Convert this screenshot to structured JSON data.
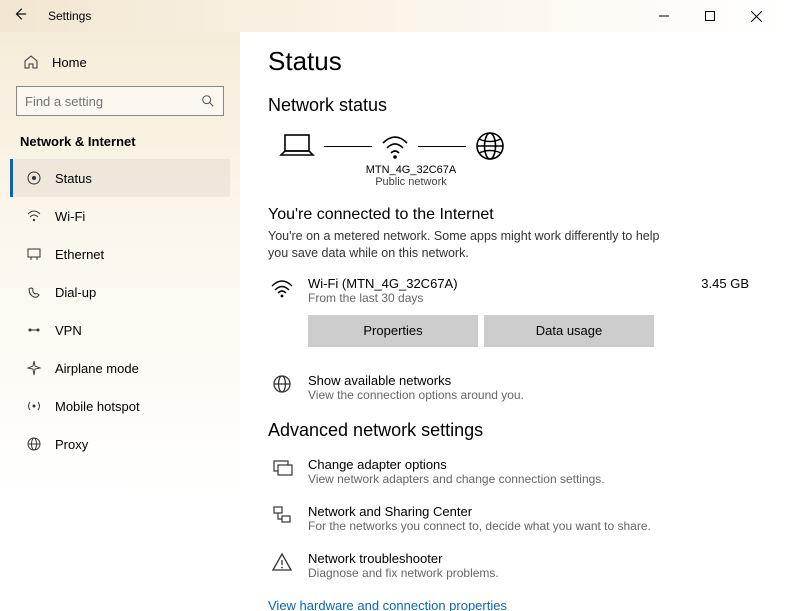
{
  "window": {
    "title": "Settings"
  },
  "sidebar": {
    "home_label": "Home",
    "search_placeholder": "Find a setting",
    "category": "Network & Internet",
    "items": [
      {
        "label": "Status",
        "icon": "status-icon"
      },
      {
        "label": "Wi-Fi",
        "icon": "wifi-icon"
      },
      {
        "label": "Ethernet",
        "icon": "ethernet-icon"
      },
      {
        "label": "Dial-up",
        "icon": "dialup-icon"
      },
      {
        "label": "VPN",
        "icon": "vpn-icon"
      },
      {
        "label": "Airplane mode",
        "icon": "airplane-icon"
      },
      {
        "label": "Mobile hotspot",
        "icon": "hotspot-icon"
      },
      {
        "label": "Proxy",
        "icon": "proxy-icon"
      }
    ]
  },
  "main": {
    "page_title": "Status",
    "network_status_heading": "Network status",
    "diagram": {
      "ssid": "MTN_4G_32C67A",
      "network_type": "Public network"
    },
    "connected_heading": "You're connected to the Internet",
    "connected_desc": "You're on a metered network. Some apps might work differently to help you save data while on this network.",
    "connection": {
      "name": "Wi-Fi (MTN_4G_32C67A)",
      "period": "From the last 30 days",
      "usage": "3.45 GB"
    },
    "properties_btn": "Properties",
    "data_usage_btn": "Data usage",
    "available": {
      "title": "Show available networks",
      "desc": "View the connection options around you."
    },
    "advanced_heading": "Advanced network settings",
    "adapter": {
      "title": "Change adapter options",
      "desc": "View network adapters and change connection settings."
    },
    "sharing": {
      "title": "Network and Sharing Center",
      "desc": "For the networks you connect to, decide what you want to share."
    },
    "troubleshoot": {
      "title": "Network troubleshooter",
      "desc": "Diagnose and fix network problems."
    },
    "hardware_link": "View hardware and connection properties"
  }
}
